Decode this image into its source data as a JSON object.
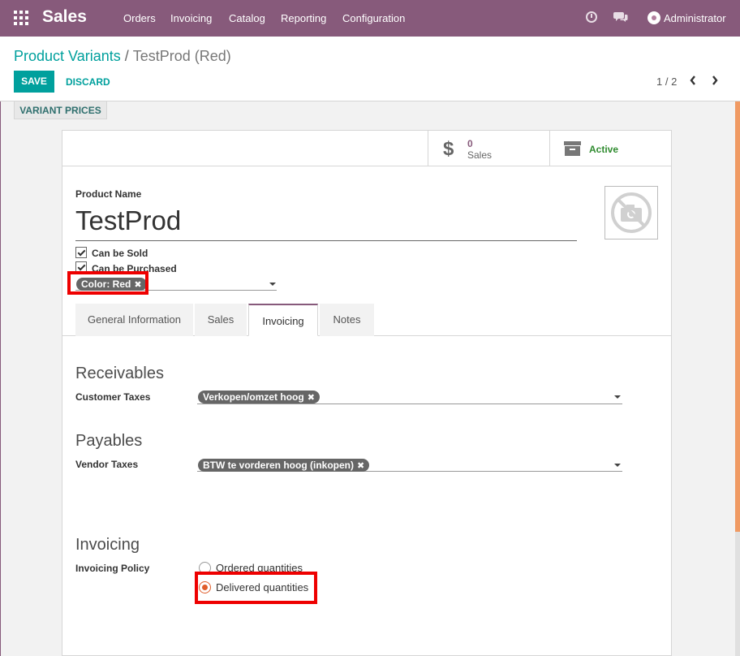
{
  "navbar": {
    "app_name": "Sales",
    "menu": [
      "Orders",
      "Invoicing",
      "Catalog",
      "Reporting",
      "Configuration"
    ],
    "user": "Administrator"
  },
  "control_panel": {
    "breadcrumb_parent": "Product Variants",
    "breadcrumb_separator": "/",
    "breadcrumb_current": "TestProd (Red)",
    "save_label": "SAVE",
    "discard_label": "DISCARD",
    "pager": "1 / 2"
  },
  "statusbar": {
    "variant_prices_label": "VARIANT PRICES"
  },
  "smart_buttons": {
    "sales_value": "0",
    "sales_label": "Sales",
    "active_label": "Active"
  },
  "form": {
    "product_name_label": "Product Name",
    "product_name": "TestProd",
    "can_be_sold": "Can be Sold",
    "can_be_purchased": "Can be Purchased",
    "attribute_tag": "Color: Red"
  },
  "tabs": [
    {
      "label": "General Information",
      "active": false
    },
    {
      "label": "Sales",
      "active": false
    },
    {
      "label": "Invoicing",
      "active": true
    },
    {
      "label": "Notes",
      "active": false
    }
  ],
  "invoicing_tab": {
    "receivables_title": "Receivables",
    "customer_taxes_label": "Customer Taxes",
    "customer_tax_tag": "Verkopen/omzet hoog",
    "payables_title": "Payables",
    "vendor_taxes_label": "Vendor Taxes",
    "vendor_tax_tag": "BTW te vorderen hoog (inkopen)",
    "invoicing_title": "Invoicing",
    "invoicing_policy_label": "Invoicing Policy",
    "policy_options": [
      "Ordered quantities",
      "Delivered quantities"
    ],
    "policy_selected": "Delivered quantities"
  },
  "colors": {
    "brand": "#875a7b",
    "accent": "#00a09d",
    "highlight": "#ee0000",
    "radio_selected": "#e05d2a"
  },
  "icons": [
    "apps-icon",
    "clock-icon",
    "chat-icon",
    "dollar-icon",
    "archive-icon",
    "no-photo-icon",
    "chevron-left-icon",
    "chevron-right-icon",
    "remove-tag-icon",
    "dropdown-caret-icon"
  ]
}
